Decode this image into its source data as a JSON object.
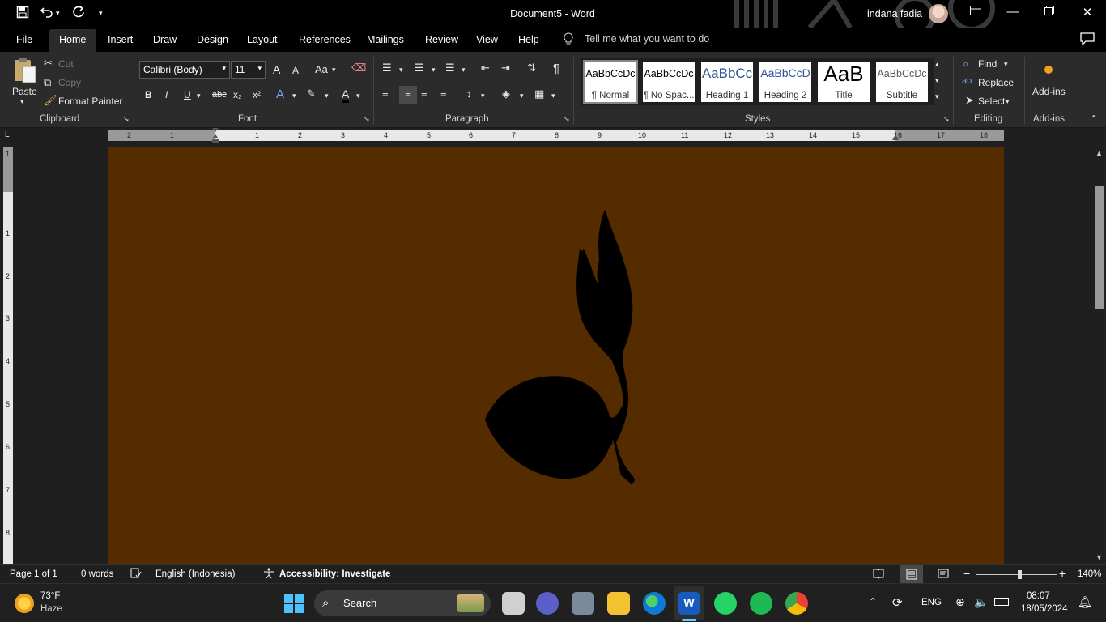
{
  "window": {
    "doc_title": "Document5  -  Word",
    "user_name": "indana fadia"
  },
  "quick_access": {
    "save_icon": "save-icon",
    "undo_icon": "undo-icon",
    "redo_icon": "redo-icon",
    "customize_icon": "chevron-down-icon"
  },
  "tabs": [
    {
      "label": "File"
    },
    {
      "label": "Home"
    },
    {
      "label": "Insert"
    },
    {
      "label": "Draw"
    },
    {
      "label": "Design"
    },
    {
      "label": "Layout"
    },
    {
      "label": "References"
    },
    {
      "label": "Mailings"
    },
    {
      "label": "Review"
    },
    {
      "label": "View"
    },
    {
      "label": "Help"
    }
  ],
  "tell_me": "Tell me what you want to do",
  "clipboard": {
    "paste": "Paste",
    "cut": "Cut",
    "copy": "Copy",
    "format_painter": "Format Painter",
    "label": "Clipboard"
  },
  "font": {
    "name": "Calibri (Body)",
    "size": "11",
    "label": "Font",
    "bold": "B",
    "italic": "I",
    "underline": "U",
    "strike": "abc",
    "sub": "x₂",
    "sup": "x²",
    "change_case": "Aa",
    "grow": "A",
    "shrink": "A",
    "font_color": "A"
  },
  "paragraph": {
    "label": "Paragraph",
    "pilcrow": "¶"
  },
  "styles": {
    "label": "Styles",
    "items": [
      {
        "preview": "AaBbCcDc",
        "name": "¶ Normal",
        "color": "#000000"
      },
      {
        "preview": "AaBbCcDc",
        "name": "¶ No Spac...",
        "color": "#000000"
      },
      {
        "preview": "AaBbCc",
        "name": "Heading 1",
        "color": "#2f5496"
      },
      {
        "preview": "AaBbCcD",
        "name": "Heading 2",
        "color": "#2f5496"
      },
      {
        "preview": "AaB",
        "name": "Title",
        "color": "#000000"
      },
      {
        "preview": "AaBbCcDc",
        "name": "Subtitle",
        "color": "#595959"
      }
    ]
  },
  "editing": {
    "label": "Editing",
    "find": "Find",
    "replace": "Replace",
    "select": "Select"
  },
  "addins": {
    "label": "Add-ins",
    "button": "Add-ins"
  },
  "ruler": {
    "numbers": [
      "2",
      "1",
      "1",
      "2",
      "3",
      "4",
      "5",
      "6",
      "7",
      "8",
      "9",
      "10",
      "11",
      "12",
      "13",
      "14",
      "15",
      "16",
      "17",
      "18"
    ],
    "vnumbers": [
      "1",
      "1",
      "2",
      "3",
      "4",
      "5",
      "6",
      "7",
      "8"
    ]
  },
  "page": {
    "background": "#552b00",
    "shape_color": "#000000"
  },
  "status": {
    "page": "Page 1 of 1",
    "words": "0 words",
    "language": "English (Indonesia)",
    "accessibility": "Accessibility: Investigate",
    "zoom": "140%"
  },
  "taskbar": {
    "weather_temp": "73°F",
    "weather_desc": "Haze",
    "search": "Search",
    "lang": "ENG",
    "time": "08:07",
    "date": "18/05/2024"
  }
}
